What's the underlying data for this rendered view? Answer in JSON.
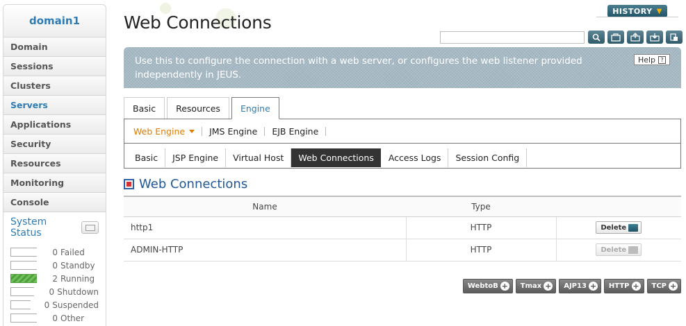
{
  "sidebar": {
    "domain": "domain1",
    "items": [
      {
        "label": "Domain"
      },
      {
        "label": "Sessions"
      },
      {
        "label": "Clusters"
      },
      {
        "label": "Servers",
        "active": true
      },
      {
        "label": "Applications"
      },
      {
        "label": "Security"
      },
      {
        "label": "Resources"
      },
      {
        "label": "Monitoring"
      },
      {
        "label": "Console"
      }
    ],
    "status": {
      "title": "System Status",
      "rows": [
        {
          "count": "0",
          "label": "Failed"
        },
        {
          "count": "0",
          "label": "Standby"
        },
        {
          "count": "2",
          "label": "Running"
        },
        {
          "count": "0",
          "label": "Shutdown"
        },
        {
          "count": "0",
          "label": "Suspended"
        },
        {
          "count": "0",
          "label": "Other"
        }
      ]
    }
  },
  "header": {
    "title": "Web Connections",
    "history_label": "HISTORY",
    "search_value": "",
    "tool_icons": [
      "search-icon",
      "refresh-icon",
      "export-xml-icon",
      "import-xml-icon",
      "download-icon"
    ]
  },
  "banner": {
    "text": "Use this to configure the connection with a web server, or configures the web listener provided independently in JEUS.",
    "help_label": "Help"
  },
  "tabs": {
    "main": [
      "Basic",
      "Resources",
      "Engine"
    ],
    "sub": [
      "Web Engine",
      "JMS Engine",
      "EJB Engine"
    ],
    "sub2": [
      "Basic",
      "JSP Engine",
      "Virtual Host",
      "Web Connections",
      "Access Logs",
      "Session Config"
    ]
  },
  "section": {
    "title": "Web Connections"
  },
  "table": {
    "columns": [
      "Name",
      "Type",
      ""
    ],
    "rows": [
      {
        "name": "http1",
        "type": "HTTP",
        "action": "Delete",
        "enabled": true
      },
      {
        "name": "ADMIN-HTTP",
        "type": "HTTP",
        "action": "Delete",
        "enabled": false
      }
    ]
  },
  "add_buttons": [
    "WebtoB",
    "Tmax",
    "AJP13",
    "HTTP",
    "TCP"
  ]
}
